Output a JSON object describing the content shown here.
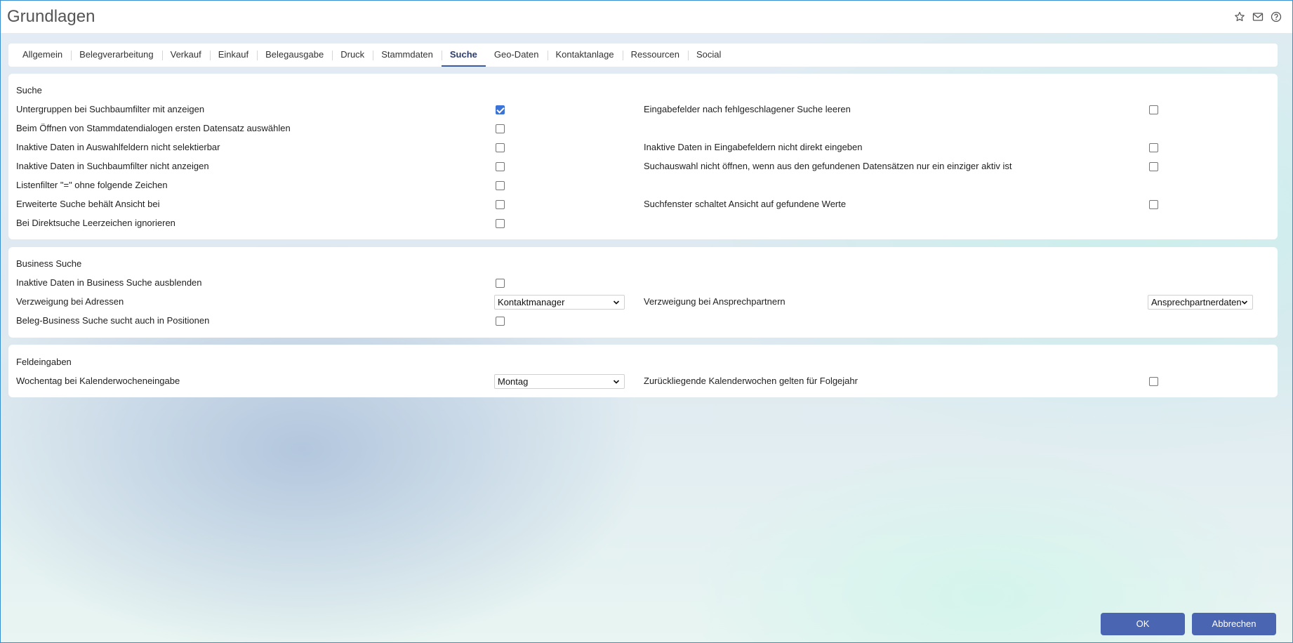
{
  "window": {
    "title": "Grundlagen",
    "icons": [
      "star-icon",
      "mail-icon",
      "help-icon"
    ]
  },
  "tabs": [
    {
      "label": "Allgemein",
      "active": false
    },
    {
      "label": "Belegverarbeitung",
      "active": false
    },
    {
      "label": "Verkauf",
      "active": false
    },
    {
      "label": "Einkauf",
      "active": false
    },
    {
      "label": "Belegausgabe",
      "active": false
    },
    {
      "label": "Druck",
      "active": false
    },
    {
      "label": "Stammdaten",
      "active": false
    },
    {
      "label": "Suche",
      "active": true
    },
    {
      "label": "Geo-Daten",
      "active": false
    },
    {
      "label": "Kontaktanlage",
      "active": false
    },
    {
      "label": "Ressourcen",
      "active": false
    },
    {
      "label": "Social",
      "active": false
    }
  ],
  "suche": {
    "title": "Suche",
    "left": [
      {
        "label": "Untergruppen bei Suchbaumfilter mit anzeigen",
        "checked": true
      },
      {
        "label": "Beim Öffnen von Stammdatendialogen ersten Datensatz auswählen",
        "checked": false
      },
      {
        "label": "Inaktive Daten in Auswahlfeldern nicht selektierbar",
        "checked": false
      },
      {
        "label": "Inaktive Daten in Suchbaumfilter nicht anzeigen",
        "checked": false
      },
      {
        "label": "Listenfilter \"=\" ohne folgende Zeichen",
        "checked": false
      },
      {
        "label": "Erweiterte Suche behält Ansicht bei",
        "checked": false
      },
      {
        "label": "Bei Direktsuche Leerzeichen ignorieren",
        "checked": false
      }
    ],
    "right": [
      {
        "label": "Eingabefelder nach fehlgeschlagener Suche leeren",
        "checked": false
      },
      {
        "label": "Inaktive Daten in Eingabefeldern nicht direkt eingeben",
        "checked": false
      },
      {
        "label": "Suchauswahl nicht öffnen, wenn aus den gefundenen Datensätzen nur ein einziger aktiv ist",
        "checked": false
      },
      {
        "label": "Suchfenster schaltet Ansicht auf gefundene Werte",
        "checked": false
      }
    ]
  },
  "business": {
    "title": "Business Suche",
    "inactive_label": "Inaktive Daten in Business Suche ausblenden",
    "inactive_checked": false,
    "adressen_label": "Verzweigung bei Adressen",
    "adressen_value": "Kontaktmanager",
    "ansprech_label": "Verzweigung bei Ansprechpartnern",
    "ansprech_value": "Ansprechpartnerdaten",
    "positionen_label": "Beleg-Business Suche sucht auch in Positionen",
    "positionen_checked": false
  },
  "feld": {
    "title": "Feldeingaben",
    "wochentag_label": "Wochentag bei Kalenderwocheneingabe",
    "wochentag_value": "Montag",
    "kw_label": "Zurückliegende Kalenderwochen gelten für Folgejahr",
    "kw_checked": false
  },
  "buttons": {
    "ok": "OK",
    "cancel": "Abbrechen"
  }
}
